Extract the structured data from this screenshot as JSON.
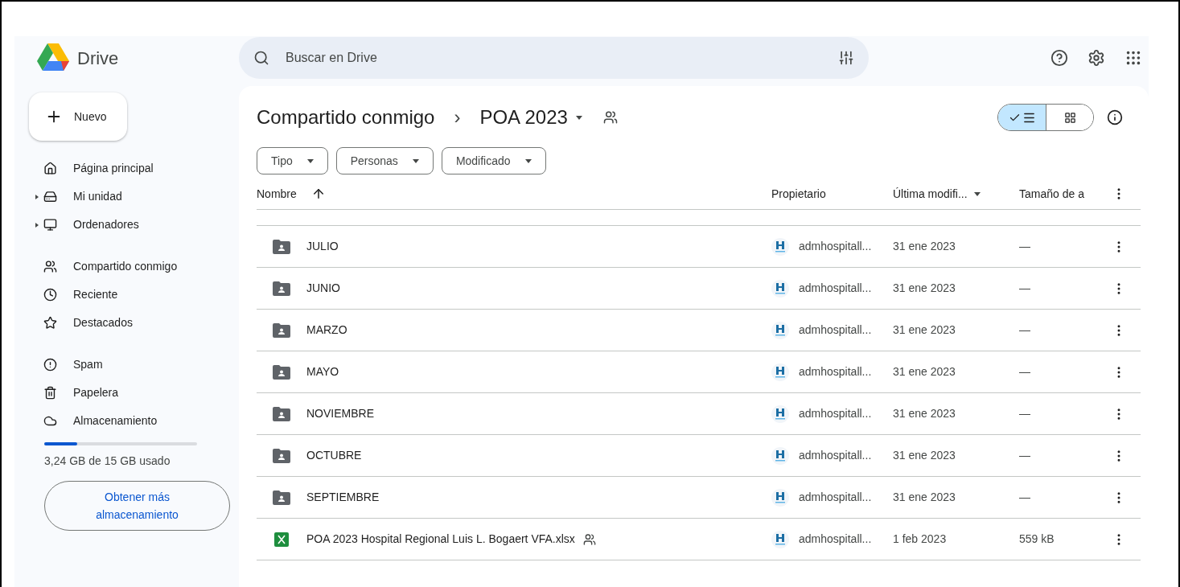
{
  "app": {
    "name": "Drive"
  },
  "search": {
    "placeholder": "Buscar en Drive"
  },
  "new_button": {
    "label": "Nuevo"
  },
  "sidebar": {
    "groups": [
      [
        {
          "label": "Página principal",
          "expandable": false,
          "selected": false
        },
        {
          "label": "Mi unidad",
          "expandable": true,
          "selected": false
        },
        {
          "label": "Ordenadores",
          "expandable": true,
          "selected": false
        }
      ],
      [
        {
          "label": "Compartido conmigo",
          "expandable": false,
          "selected": false
        },
        {
          "label": "Reciente",
          "expandable": false,
          "selected": false
        },
        {
          "label": "Destacados",
          "expandable": false,
          "selected": false
        }
      ],
      [
        {
          "label": "Spam",
          "expandable": false,
          "selected": false
        },
        {
          "label": "Papelera",
          "expandable": false,
          "selected": false
        },
        {
          "label": "Almacenamiento",
          "expandable": false,
          "selected": false
        }
      ]
    ]
  },
  "storage": {
    "level": 0.216,
    "text": "3,24 GB de 15 GB usado",
    "button": "Obtener más almacenamiento"
  },
  "breadcrumb": {
    "parent": "Compartido conmigo",
    "separator": "›",
    "current": "POA 2023",
    "shared": true
  },
  "view_toggle": [
    {
      "kind": "list",
      "selected": true
    },
    {
      "kind": "grid",
      "selected": false
    }
  ],
  "filters": [
    "Tipo",
    "Personas",
    "Modificado"
  ],
  "table": {
    "columns": [
      {
        "label": "Nombre",
        "kind": "sorted_ascending"
      },
      {
        "label": "Propietario",
        "kind": "plain"
      },
      {
        "label": "Última modifi...",
        "kind": "sorted_descending"
      },
      {
        "label": "Tamaño de a",
        "kind": "plain"
      }
    ],
    "rows": [
      {
        "kind": "folder",
        "name": "JULIO",
        "shared": false,
        "owner": "admhospitall...",
        "modified": "31 ene 2023",
        "size": "—"
      },
      {
        "kind": "folder",
        "name": "JUNIO",
        "shared": false,
        "owner": "admhospitall...",
        "modified": "31 ene 2023",
        "size": "—"
      },
      {
        "kind": "folder",
        "name": "MARZO",
        "shared": false,
        "owner": "admhospitall...",
        "modified": "31 ene 2023",
        "size": "—"
      },
      {
        "kind": "folder",
        "name": "MAYO",
        "shared": false,
        "owner": "admhospitall...",
        "modified": "31 ene 2023",
        "size": "—"
      },
      {
        "kind": "folder",
        "name": "NOVIEMBRE",
        "shared": false,
        "owner": "admhospitall...",
        "modified": "31 ene 2023",
        "size": "—"
      },
      {
        "kind": "folder",
        "name": "OCTUBRE",
        "shared": false,
        "owner": "admhospitall...",
        "modified": "31 ene 2023",
        "size": "—"
      },
      {
        "kind": "folder",
        "name": "SEPTIEMBRE",
        "shared": false,
        "owner": "admhospitall...",
        "modified": "31 ene 2023",
        "size": "—"
      },
      {
        "kind": "sheet",
        "name": "POA 2023 Hospital Regional Luis L. Bogaert VFA.xlsx",
        "shared": true,
        "owner": "admhospitall...",
        "modified": "1 feb 2023",
        "size": "559 kB"
      }
    ]
  }
}
